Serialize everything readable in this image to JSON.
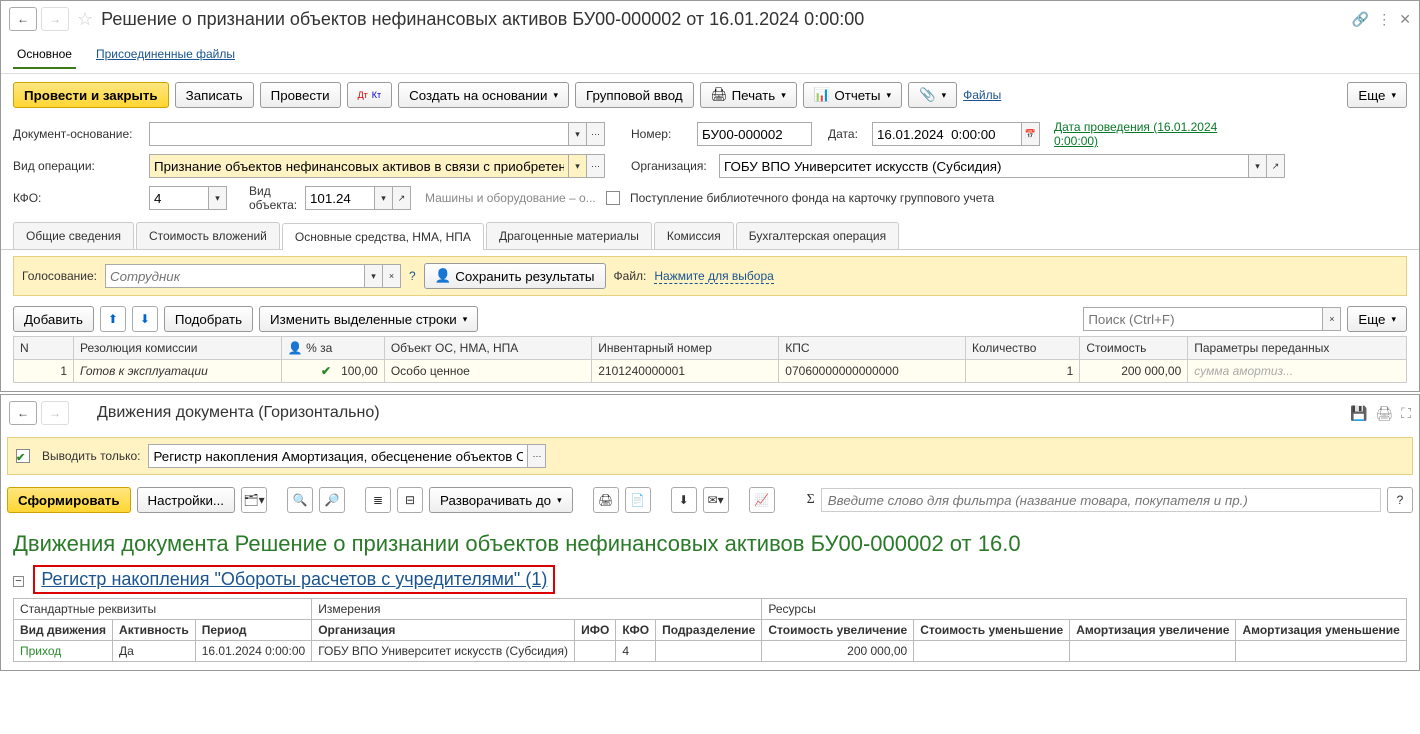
{
  "win1": {
    "title": "Решение о признании объектов нефинансовых активов БУ00-000002 от 16.01.2024 0:00:00",
    "section_tabs": {
      "main": "Основное",
      "attached": "Присоединенные файлы"
    },
    "toolbar": {
      "post_close": "Провести и закрыть",
      "write": "Записать",
      "post": "Провести",
      "create_based": "Создать на основании",
      "group_input": "Групповой ввод",
      "print": "Печать",
      "reports": "Отчеты",
      "files": "Файлы",
      "more": "Еще"
    },
    "form": {
      "doc_basis_lbl": "Документ-основание:",
      "number_lbl": "Номер:",
      "number": "БУ00-000002",
      "date_lbl": "Дата:",
      "date": "16.01.2024  0:00:00",
      "posting_date_link": "Дата проведения (16.01.2024 0:00:00)",
      "op_type_lbl": "Вид операции:",
      "op_type": "Признание объектов нефинансовых активов в связи с приобретением",
      "org_lbl": "Организация:",
      "org": "ГОБУ ВПО Университет искусств (Субсидия)",
      "kfo_lbl": "КФО:",
      "kfo": "4",
      "obj_type_lbl": "Вид объекта:",
      "obj_type": "101.24",
      "obj_type_desc": "Машины и оборудование – о...",
      "lib_fund": "Поступление библиотечного фонда на карточку группового учета"
    },
    "inner_tabs": {
      "t1": "Общие сведения",
      "t2": "Стоимость вложений",
      "t3": "Основные средства, НМА, НПА",
      "t4": "Драгоценные материалы",
      "t5": "Комиссия",
      "t6": "Бухгалтерская операция"
    },
    "vote": {
      "label": "Голосование:",
      "placeholder": "Сотрудник",
      "save_results": "Сохранить результаты",
      "file_lbl": "Файл:",
      "file_link": "Нажмите для выбора"
    },
    "grid_tb": {
      "add": "Добавить",
      "pick": "Подобрать",
      "edit_rows": "Изменить выделенные строки",
      "search_ph": "Поиск (Ctrl+F)",
      "more": "Еще"
    },
    "grid": {
      "h": {
        "n": "N",
        "res": "Резолюция комиссии",
        "pct": "% за",
        "obj": "Объект ОС, НМА, НПА",
        "inv": "Инвентарный номер",
        "kps": "КПС",
        "qty": "Количество",
        "cost": "Стоимость",
        "params": "Параметры переданных"
      },
      "row": {
        "n": "1",
        "res": "Готов к эксплуатации",
        "pct": "100,00",
        "obj": "Особо ценное",
        "inv": "2101240000001",
        "kps": "07060000000000000",
        "qty": "1",
        "cost": "200 000,00",
        "params": "сумма амортиз..."
      }
    }
  },
  "win2": {
    "title": "Движения документа (Горизонтально)",
    "output_only": "Выводить только:",
    "register_filter": "Регистр накопления Амортизация, обесценение объектов ОС, Н",
    "tb": {
      "generate": "Сформировать",
      "settings": "Настройки...",
      "expand": "Разворачивать до",
      "filter_ph": "Введите слово для фильтра (название товара, покупателя и пр.)"
    },
    "report_title": "Движения документа Решение о признании объектов нефинансовых активов БУ00-000002 от 16.0",
    "register_link": "Регистр накопления \"Обороты расчетов с учредителями\" (1)",
    "rt": {
      "gh": {
        "g1": "Стандартные реквизиты",
        "g2": "Измерения",
        "g3": "Ресурсы"
      },
      "h": {
        "move": "Вид движения",
        "active": "Активность",
        "period": "Период",
        "org": "Организация",
        "ifo": "ИФО",
        "kfo": "КФО",
        "dept": "Подразделение",
        "cost_inc": "Стоимость увеличение",
        "cost_dec": "Стоимость уменьшение",
        "amort_inc": "Амортизация увеличение",
        "amort_dec": "Амортизация уменьшение"
      },
      "row": {
        "move": "Приход",
        "active": "Да",
        "period": "16.01.2024 0:00:00",
        "org": "ГОБУ ВПО Университет искусств (Субсидия)",
        "ifo": "",
        "kfo": "4",
        "dept": "",
        "cost_inc": "200 000,00",
        "cost_dec": "",
        "amort_inc": "",
        "amort_dec": ""
      }
    }
  }
}
